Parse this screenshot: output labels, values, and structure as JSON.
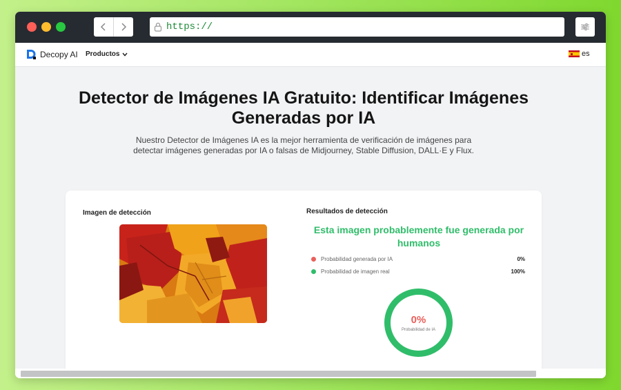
{
  "browser": {
    "url": "https://",
    "back_icon": "chevron-left-icon",
    "forward_icon": "chevron-right-icon",
    "lock_icon": "lock-icon",
    "settings_icon": "sliders-icon"
  },
  "site_nav": {
    "brand": "Decopy AI",
    "menu_label": "Productos",
    "language": "es"
  },
  "hero": {
    "title": "Detector de Imágenes IA Gratuito: Identificar Imágenes Generadas por IA",
    "description": "Nuestro Detector de Imágenes IA es la mejor herramienta de verificación de imágenes para detectar imágenes generadas por IA o falsas de Midjourney, Stable Diffusion, DALL·E y Flux."
  },
  "detection": {
    "image_label": "Imagen de detección",
    "results_label": "Resultados de detección",
    "verdict": "Esta imagen probablemente fue generada por humanos",
    "rows": [
      {
        "label": "Probabilidad generada por IA",
        "value": "0%",
        "color": "#e9605b"
      },
      {
        "label": "Probabilidad de imagen real",
        "value": "100%",
        "color": "#30bd6a"
      }
    ],
    "gauge": {
      "value_text": "0%",
      "caption": "Probabilidad de IA",
      "ai_fraction": 0,
      "ring_color": "#30bd6a",
      "value_color": "#e9605b"
    }
  },
  "colors": {
    "accent_green": "#30bd6a",
    "accent_red": "#e9605b",
    "brand_blue": "#1a73e8"
  }
}
